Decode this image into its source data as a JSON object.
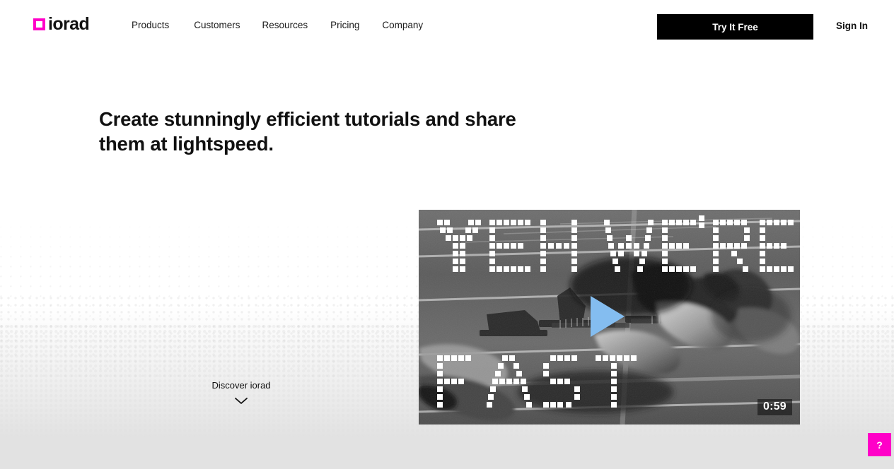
{
  "header": {
    "logo": {
      "text": "iorad",
      "mark_color": "#ff00c8",
      "icon": "square-outline-icon"
    },
    "nav_items": [
      {
        "label": "Products"
      },
      {
        "label": "Customers"
      },
      {
        "label": "Resources"
      },
      {
        "label": "Pricing"
      },
      {
        "label": "Company"
      }
    ],
    "cta": {
      "label": "Try It Free",
      "bg": "#000000",
      "fg": "#ffffff"
    },
    "signin": {
      "label": "Sign In"
    }
  },
  "hero": {
    "headline": "Create stunningly efficient tutorials and share them at lightspeed.",
    "discover": {
      "label": "Discover iorad",
      "icon": "chevron-down-icon"
    }
  },
  "video": {
    "overlay_text_top": "YEH WE'RE",
    "overlay_text_bottom": "FAST",
    "duration": "0:59",
    "play_icon": "play-triangle-icon",
    "play_color": "#84bdf0",
    "scene": "black-and-white photo of sprinters bursting from starting blocks on a running track"
  },
  "help": {
    "label": "?",
    "color": "#ff00c8",
    "icon": "question-mark-icon"
  }
}
